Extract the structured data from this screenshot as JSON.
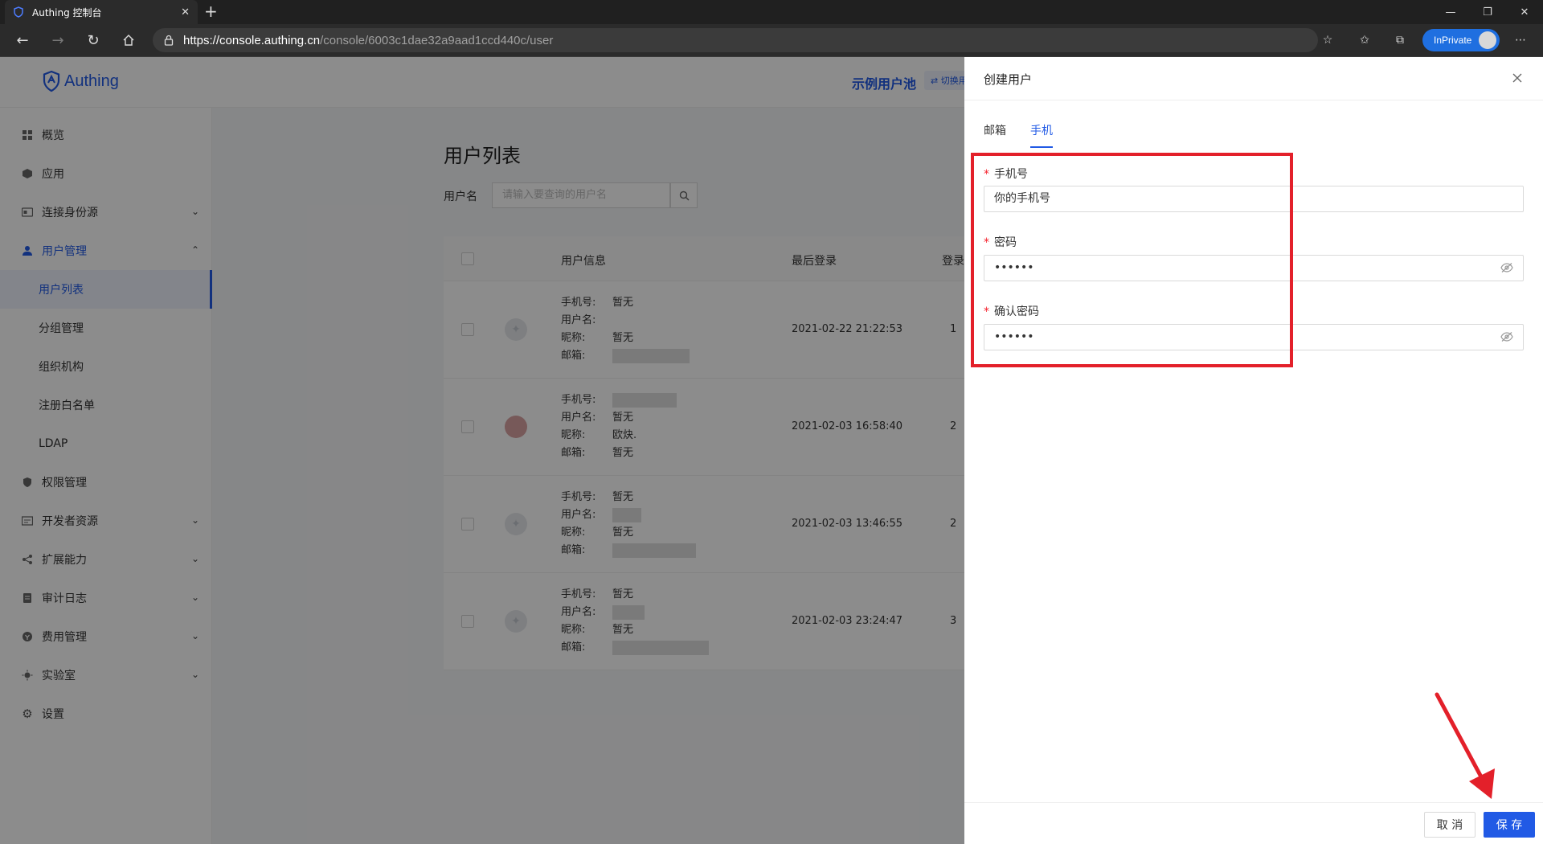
{
  "browser": {
    "tab_title": "Authing 控制台",
    "url_host": "https://console.authing.cn",
    "url_path": "/console/6003c1dae32a9aad1ccd440c/user",
    "inprivate_label": "InPrivate"
  },
  "header": {
    "logo_text": "Authing",
    "userpool_name": "示例用户池",
    "switch_label": "切换用"
  },
  "sidebar": {
    "items": [
      {
        "label": "概览",
        "icon": "dashboard-icon"
      },
      {
        "label": "应用",
        "icon": "cube-icon"
      },
      {
        "label": "连接身份源",
        "icon": "id-card-icon"
      },
      {
        "label": "用户管理",
        "icon": "user-icon"
      },
      {
        "label": "用户列表"
      },
      {
        "label": "分组管理"
      },
      {
        "label": "组织机构"
      },
      {
        "label": "注册白名单"
      },
      {
        "label": "LDAP"
      },
      {
        "label": "权限管理",
        "icon": "shield-icon"
      },
      {
        "label": "开发者资源",
        "icon": "code-icon"
      },
      {
        "label": "扩展能力",
        "icon": "share-icon"
      },
      {
        "label": "审计日志",
        "icon": "log-icon"
      },
      {
        "label": "费用管理",
        "icon": "coin-icon"
      },
      {
        "label": "实验室",
        "icon": "bulb-icon"
      },
      {
        "label": "设置",
        "icon": "gear-icon"
      }
    ]
  },
  "main": {
    "title": "用户列表",
    "filter_label": "用户名",
    "filter_placeholder": "请输入要查询的用户名",
    "columns": [
      "用户信息",
      "最后登录",
      "登录"
    ],
    "labels": {
      "phone": "手机号:",
      "username": "用户名:",
      "nickname": "昵称:",
      "email": "邮箱:"
    },
    "rows": [
      {
        "phone": "暂无",
        "username": "",
        "nickname": "暂无",
        "email": "",
        "last_login": "2021-02-22 21:22:53",
        "count": "1"
      },
      {
        "phone": "",
        "username": "暂无",
        "nickname": "欧炔.",
        "email": "暂无",
        "last_login": "2021-02-03 16:58:40",
        "count": "2"
      },
      {
        "phone": "暂无",
        "username": "",
        "nickname": "暂无",
        "email": "",
        "last_login": "2021-02-03 13:46:55",
        "count": "2"
      },
      {
        "phone": "暂无",
        "username": "",
        "nickname": "暂无",
        "email": "",
        "last_login": "2021-02-03 23:24:47",
        "count": "3"
      }
    ]
  },
  "drawer": {
    "title": "创建用户",
    "tabs": [
      "邮箱",
      "手机"
    ],
    "active_tab": "手机",
    "phone_label": "手机号",
    "phone_value": "你的手机号",
    "password_label": "密码",
    "password_value": "••••••",
    "confirm_label": "确认密码",
    "confirm_value": "••••••",
    "cancel_label": "取 消",
    "save_label": "保 存"
  },
  "colors": {
    "accent": "#215ae5",
    "highlight": "#e3202a",
    "required": "#f5222d"
  }
}
